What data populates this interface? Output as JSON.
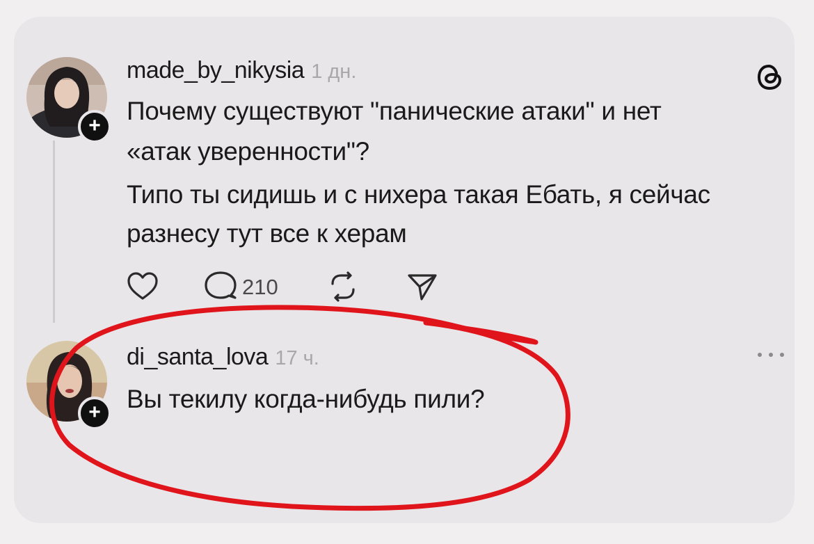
{
  "post": {
    "username": "made_by_nikysia",
    "time": "1 дн.",
    "text_line1": "Почему существуют \"панические атаки\" и нет",
    "text_line2": "«атак уверенности\"?",
    "text_line3": "Типо ты сидишь и с нихера такая Ебать, я сейчас",
    "text_line4": "разнесу тут все к херам",
    "reply_count": "210",
    "follow_badge": "+"
  },
  "reply": {
    "username": "di_santa_lova",
    "time": "17 ч.",
    "text": "Вы текилу когда-нибудь пили?",
    "follow_badge": "+"
  },
  "icons": {
    "like": "heart-icon",
    "comment": "comment-icon",
    "repost": "repost-icon",
    "share": "share-icon",
    "brand": "threads-logo-icon",
    "more": "more-icon"
  },
  "colors": {
    "card_background": "#e9e6e9",
    "annotation_circle": "#e0141b",
    "muted_text": "#a9a7a9"
  }
}
